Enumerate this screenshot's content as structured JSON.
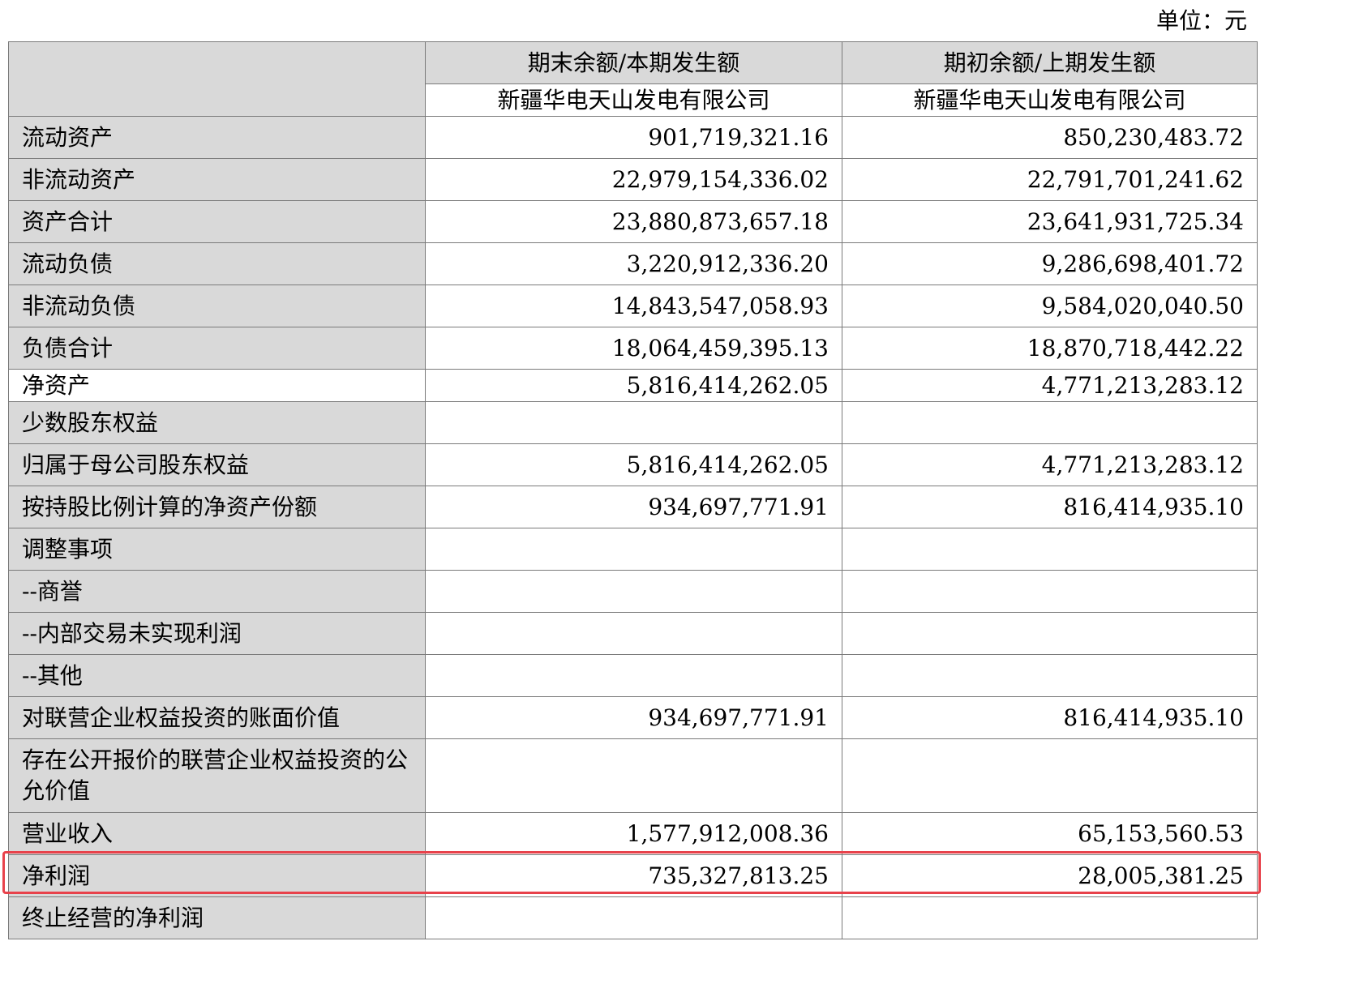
{
  "unit_label": "单位：元",
  "header": {
    "col1_title": "期末余额/本期发生额",
    "col2_title": "期初余额/上期发生额",
    "col1_company": "新疆华电天山发电有限公司",
    "col2_company": "新疆华电天山发电有限公司"
  },
  "rows": [
    {
      "label": "流动资产",
      "current": "901,719,321.16",
      "prior": "850,230,483.72"
    },
    {
      "label": "非流动资产",
      "current": "22,979,154,336.02",
      "prior": "22,791,701,241.62"
    },
    {
      "label": "资产合计",
      "current": "23,880,873,657.18",
      "prior": "23,641,931,725.34"
    },
    {
      "label": "流动负债",
      "current": "3,220,912,336.20",
      "prior": "9,286,698,401.72"
    },
    {
      "label": "非流动负债",
      "current": "14,843,547,058.93",
      "prior": "9,584,020,040.50"
    },
    {
      "label": "负债合计",
      "current": "18,064,459,395.13",
      "prior": "18,870,718,442.22"
    },
    {
      "label": "净资产",
      "current": "5,816,414,262.05",
      "prior": "4,771,213,283.12"
    },
    {
      "label": "少数股东权益",
      "current": "",
      "prior": ""
    },
    {
      "label": "归属于母公司股东权益",
      "current": "5,816,414,262.05",
      "prior": "4,771,213,283.12"
    },
    {
      "label": "按持股比例计算的净资产份额",
      "current": "934,697,771.91",
      "prior": "816,414,935.10"
    },
    {
      "label": "调整事项",
      "current": "",
      "prior": ""
    },
    {
      "label": "--商誉",
      "current": "",
      "prior": ""
    },
    {
      "label": "--内部交易未实现利润",
      "current": "",
      "prior": ""
    },
    {
      "label": "--其他",
      "current": "",
      "prior": ""
    },
    {
      "label": "对联营企业权益投资的账面价值",
      "current": "934,697,771.91",
      "prior": "816,414,935.10"
    },
    {
      "label": "存在公开报价的联营企业权益投资的公允价值",
      "current": "",
      "prior": ""
    },
    {
      "label": "营业收入",
      "current": "1,577,912,008.36",
      "prior": "65,153,560.53"
    },
    {
      "label": "净利润",
      "current": "735,327,813.25",
      "prior": "28,005,381.25"
    },
    {
      "label": "终止经营的净利润",
      "current": "",
      "prior": ""
    }
  ],
  "colors": {
    "label_background": "#d9d9d9",
    "highlight_border": "#e8424b"
  }
}
